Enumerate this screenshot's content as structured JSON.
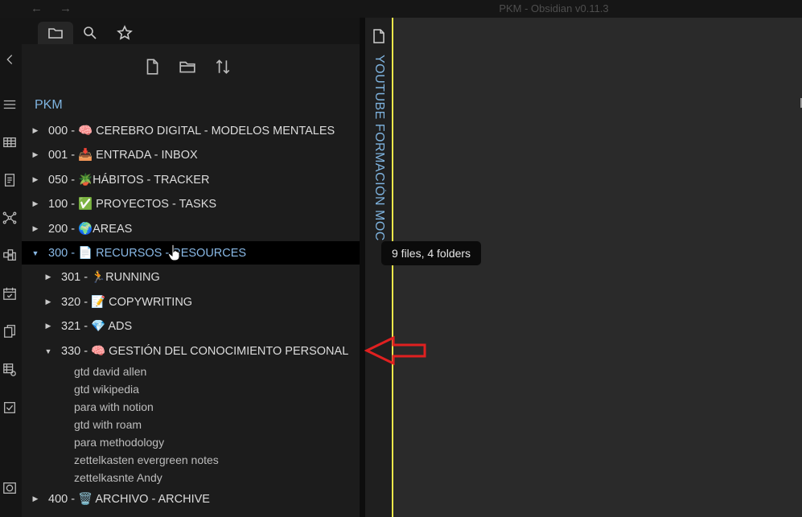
{
  "app": {
    "title": "PKM - Obsidian v0.11.3",
    "nav_back": "←",
    "nav_forward": "→"
  },
  "ribbon_icons": [
    "collapse-chevron-icon",
    "menu-icon",
    "table-icon",
    "document-list-icon",
    "graph-view-icon",
    "kanban-icon",
    "calendar-icon",
    "copy-icon",
    "table-settings-icon",
    "checkbox-icon",
    "vault-icon"
  ],
  "sidebar": {
    "tabs": [
      "folder-icon",
      "search-icon",
      "star-icon"
    ],
    "toolbar": [
      "new-note-icon",
      "new-folder-icon",
      "sort-icon"
    ],
    "vault_name": "PKM",
    "tree": [
      {
        "label": "000 - 🧠 CEREBRO DIGITAL - MODELOS MENTALES",
        "expanded": false,
        "level": 0
      },
      {
        "label": "001 - 📥 ENTRADA - INBOX",
        "expanded": false,
        "level": 0
      },
      {
        "label": "050 - 🪴HÁBITOS - TRACKER",
        "expanded": false,
        "level": 0
      },
      {
        "label": "100 - ✅ PROYECTOS - TASKS",
        "expanded": false,
        "level": 0
      },
      {
        "label": "200 - 🌍AREAS",
        "expanded": false,
        "level": 0
      },
      {
        "label": "300 - 📄 RECURSOS - RESOURCES",
        "expanded": true,
        "level": 0,
        "selected": true
      },
      {
        "label": "301 - 🏃RUNNING",
        "expanded": false,
        "level": 1
      },
      {
        "label": "320 - 📝 COPYWRITING",
        "expanded": false,
        "level": 1
      },
      {
        "label": "321 - 💎 ADS",
        "expanded": false,
        "level": 1
      },
      {
        "label": "330 - 🧠 GESTIÓN DEL CONOCIMIENTO PERSONAL",
        "expanded": true,
        "level": 1
      }
    ],
    "files": [
      "gtd david allen",
      "gtd wikipedia",
      "para with notion",
      "gtd with roam",
      "para methodology",
      "zettelkasten evergreen notes",
      "zettelkasnte Andy"
    ],
    "last_folder": {
      "label": "400 - 🗑️ ARCHIVO - ARCHIVE",
      "expanded": false
    }
  },
  "main": {
    "vertical_title": "YOUTUBE FORMACIÓN MOC",
    "tooltip": "9 files, 4 folders"
  },
  "colors": {
    "accent": "#7fb4e0",
    "highlight_line": "#f0e84a",
    "annotation_arrow": "#e02020"
  }
}
